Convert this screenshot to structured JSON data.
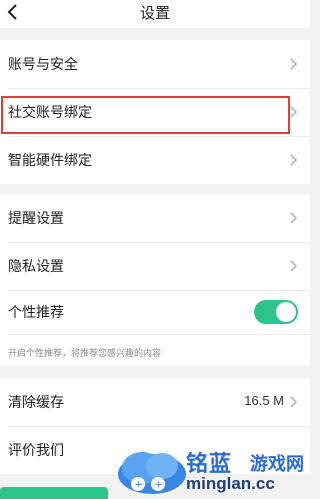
{
  "header": {
    "title": "设置"
  },
  "group1": {
    "items": [
      {
        "label": "账号与安全"
      },
      {
        "label": "社交账号绑定"
      },
      {
        "label": "智能硬件绑定"
      }
    ]
  },
  "group2": {
    "items": [
      {
        "label": "提醒设置"
      },
      {
        "label": "隐私设置"
      },
      {
        "label": "个性推荐",
        "toggle_on": true
      }
    ],
    "hint": "开启个性推荐，将推荐您感兴趣的内容"
  },
  "group3": {
    "items": [
      {
        "label": "清除缓存",
        "value": "16.5 M"
      },
      {
        "label": "评价我们"
      }
    ]
  },
  "watermark": {
    "brand_cn": "铭蓝",
    "brand_cn2": "游戏网",
    "domain": "minglan.cc"
  },
  "colors": {
    "accent": "#2bc489",
    "highlight": "#e23b3b",
    "watermark": "#2a6bd8"
  }
}
